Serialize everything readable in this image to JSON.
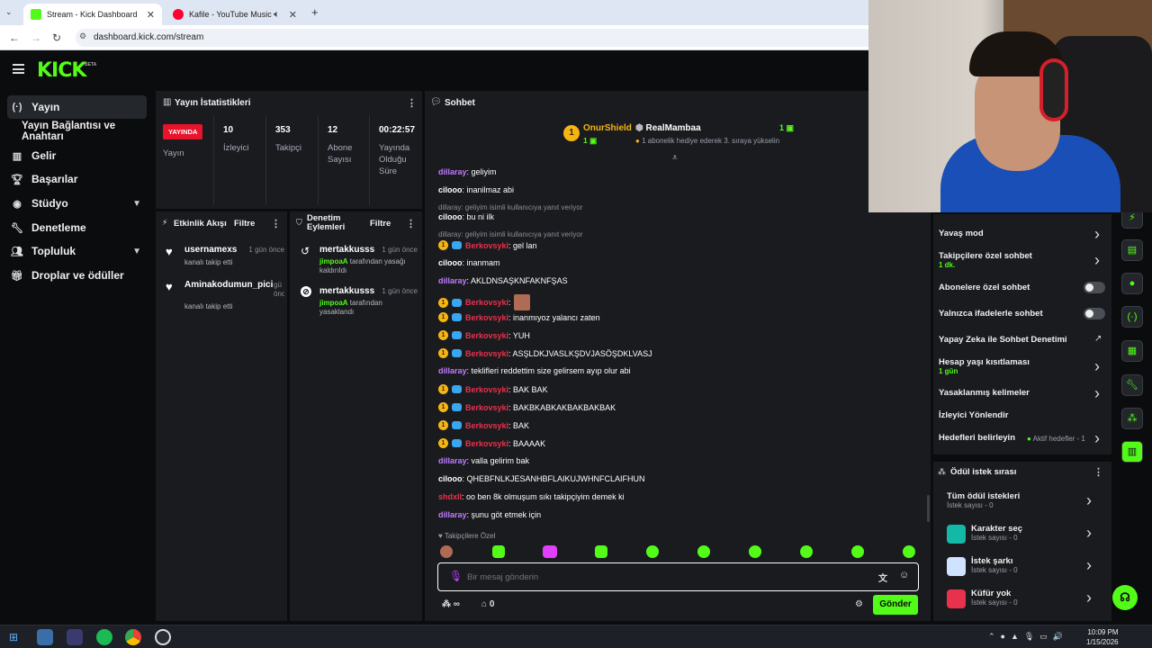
{
  "browser": {
    "tabs": [
      {
        "title": "Stream - Kick Dashboard",
        "active": true
      },
      {
        "title": "Kafile - YouTube Music",
        "active": false
      }
    ],
    "url": "dashboard.kick.com/stream"
  },
  "app": {
    "logo": "KICK",
    "beta": "BETA"
  },
  "sidebar": {
    "items": [
      {
        "label": "Yayın",
        "icon": "broadcast-icon"
      },
      {
        "label": "Yayın Bağlantısı ve Anahtarı",
        "icon": ""
      },
      {
        "label": "Gelir",
        "icon": "revenue-icon"
      },
      {
        "label": "Başarılar",
        "icon": "trophy-icon"
      },
      {
        "label": "Stüdyo",
        "icon": "studio-icon"
      },
      {
        "label": "Denetleme",
        "icon": "wrench-icon"
      },
      {
        "label": "Topluluk",
        "icon": "community-icon"
      },
      {
        "label": "Droplar ve ödüller",
        "icon": "gift-icon"
      }
    ]
  },
  "stats": {
    "title": "Yayın İstatistikleri",
    "live_badge": "YAYINDA",
    "live_label": "Yayın",
    "items": [
      {
        "value": "10",
        "label": "İzleyici"
      },
      {
        "value": "353",
        "label": "Takipçi"
      },
      {
        "value": "12",
        "label": "Abone Sayısı"
      },
      {
        "value": "00:22:57",
        "label": "Yayında Olduğu Süre"
      }
    ]
  },
  "activity": {
    "title": "Etkinlik Akışı",
    "filter": "Filtre",
    "items": [
      {
        "name": "usernamexs",
        "time": "1 gün önce",
        "desc": "kanalı takip etti"
      },
      {
        "name": "Aminakodumun_pici",
        "time": "gü önce",
        "desc": "kanalı takip etti"
      }
    ]
  },
  "modlog": {
    "title": "Denetim Eylemleri",
    "filter": "Filtre",
    "items": [
      {
        "name": "mertakkusss",
        "time": "1 gün önce",
        "actor": "jimpoaA",
        "desc": "tarafından yasağı kaldırıldı"
      },
      {
        "name": "mertakkusss",
        "time": "1 gün önce",
        "actor": "jimpoaA",
        "desc": "tarafından yasaklandı"
      }
    ]
  },
  "chat": {
    "title": "Sohbet",
    "leader": {
      "rank": "1",
      "name": "OnurShield",
      "count": "1"
    },
    "gifter": {
      "name": "RealMambaa",
      "count": "1",
      "note": "1 abonelik hediye ederek 3. sıraya yükselin"
    },
    "messages": [
      {
        "user": "dillaray",
        "text": ": geliyim",
        "color": "#c07bff"
      },
      {
        "user": "cilooo",
        "text": ": inanilmaz abi",
        "color": "#ffffff"
      },
      {
        "reply": "dillaray: geliyim isimli kullanıcıya yanıt veriyor"
      },
      {
        "user": "cilooo",
        "text": ": bu ni ilk",
        "color": "#ffffff"
      },
      {
        "reply": "dillaray: geliyim isimli kullanıcıya yanıt veriyor"
      },
      {
        "user": "Berkovsyki",
        "text": ": gel lan",
        "color": "#e8324d",
        "badges": true
      },
      {
        "user": "cilooo",
        "text": ": inanmam",
        "color": "#ffffff"
      },
      {
        "user": "dillaray",
        "text": ": AKLDNSAŞKNFAKNFŞAS",
        "color": "#c07bff"
      },
      {
        "user": "Berkovsyki",
        "text": ":",
        "color": "#e8324d",
        "badges": true,
        "emote": true
      },
      {
        "user": "Berkovsyki",
        "text": ": inanmıyoz yalancı zaten",
        "color": "#e8324d",
        "badges": true
      },
      {
        "user": "Berkovsyki",
        "text": ": YUH",
        "color": "#e8324d",
        "badges": true
      },
      {
        "user": "Berkovsyki",
        "text": ": ASŞLDKJVASLKŞDVJASÖŞDKLVASJ",
        "color": "#e8324d",
        "badges": true
      },
      {
        "user": "dillaray",
        "text": ": teklifleri reddettim size gelirsem ayıp olur abi",
        "color": "#c07bff"
      },
      {
        "user": "Berkovsyki",
        "text": ": BAK BAK",
        "color": "#e8324d",
        "badges": true
      },
      {
        "user": "Berkovsyki",
        "text": ": BAKBKABKAKBAKBAKBAK",
        "color": "#e8324d",
        "badges": true
      },
      {
        "user": "Berkovsyki",
        "text": ": BAK",
        "color": "#e8324d",
        "badges": true
      },
      {
        "user": "Berkovsyki",
        "text": ": BAAAAK",
        "color": "#e8324d",
        "badges": true
      },
      {
        "user": "dillaray",
        "text": ": valla gelirim bak",
        "color": "#c07bff"
      },
      {
        "user": "cilooo",
        "text": ": QHEBFNLKJESANHBFLAIKUJWHNFCLAIFHUN",
        "color": "#ffffff"
      },
      {
        "user": "shdxll",
        "text": ": oo ben 8k olmuşum sıkı takipçiyim demek ki",
        "color": "#e8324d"
      },
      {
        "user": "dillaray",
        "text": ": şunu göt etmek için",
        "color": "#c07bff"
      }
    ],
    "followers_only": "Takipçilere Özel",
    "input_placeholder": "Bir mesaj gönderin",
    "points": "∞",
    "gift_count": "0",
    "send": "Gönder"
  },
  "settings": {
    "items": [
      {
        "label": "Yavaş mod",
        "sub": "",
        "control": "chevron"
      },
      {
        "label": "Takipçilere özel sohbet",
        "sub": "1 dk.",
        "control": "chevron"
      },
      {
        "label": "Abonelere özel sohbet",
        "sub": "",
        "control": "toggle"
      },
      {
        "label": "Yalnızca ifadelerle sohbet",
        "sub": "",
        "control": "toggle"
      },
      {
        "label": "Yapay Zeka ile Sohbet Denetimi",
        "sub": "",
        "control": "external"
      },
      {
        "label": "Hesap yaşı kısıtlaması",
        "sub": "1 gün",
        "control": "chevron"
      },
      {
        "label": "Yasaklanmış kelimeler",
        "sub": "",
        "control": "chevron"
      },
      {
        "label": "İzleyici Yönlendir",
        "sub": "",
        "control": "none"
      },
      {
        "label": "Hedefleri belirleyin",
        "sub": "",
        "control": "chevron",
        "extra": "Aktif hedefler - 1"
      }
    ]
  },
  "rewards": {
    "title": "Ödül istek sırası",
    "items": [
      {
        "name": "Tüm ödül istekleri",
        "sub": "İstek sayısı - 0",
        "color": ""
      },
      {
        "name": "Karakter seç",
        "sub": "İstek sayısı - 0",
        "color": "#14b8a6"
      },
      {
        "name": "İstek şarkı",
        "sub": "İstek sayısı - 0",
        "color": "#cfe3ff"
      },
      {
        "name": "Küfür yok",
        "sub": "İstek sayısı - 0",
        "color": "#e8324d"
      }
    ]
  },
  "taskbar": {
    "time": "10:09 PM",
    "date": "1/15/2026"
  }
}
